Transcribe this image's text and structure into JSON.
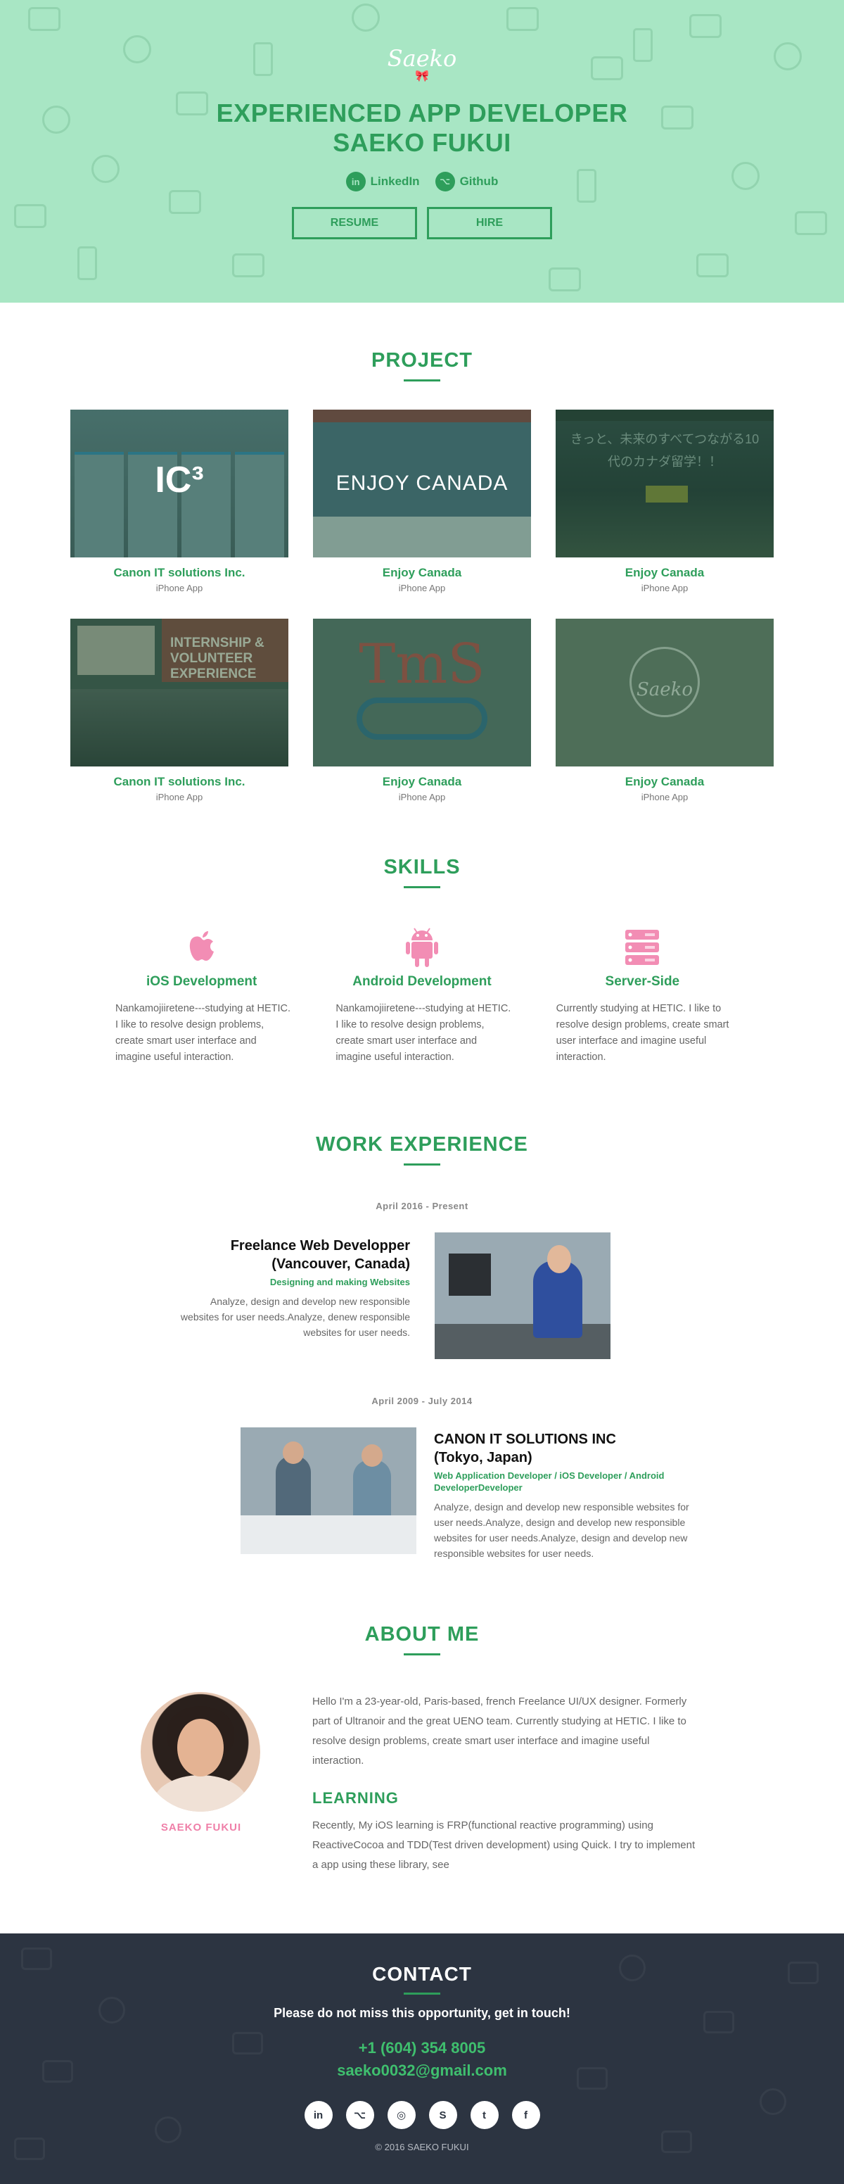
{
  "hero": {
    "logo": "Saeko",
    "logo_bow": "🎀",
    "title_line1": "EXPERIENCED APP DEVELOPER",
    "title_line2": "SAEKO FUKUI",
    "links": [
      {
        "icon": "linkedin-icon",
        "glyph": "in",
        "label": "LinkedIn"
      },
      {
        "icon": "github-icon",
        "glyph": "⌥",
        "label": "Github"
      }
    ],
    "buttons": [
      "RESUME",
      "HIRE"
    ],
    "bg_color": "#a8e6c4",
    "accent": "#2e9e5b"
  },
  "projects": {
    "title": "PROJECT",
    "thumb_texts": {
      "ic3": "IC³",
      "enjoy": "ENJOY CANADA",
      "jp_line1": "きっと、未来のすべてつながる10",
      "jp_line2": "代のカナダ留学！！",
      "internship": "INTERNSHIP & VOLUNTEER EXPERIENCE",
      "tms": "TmS",
      "saeko": "Saeko"
    },
    "items": [
      {
        "name": "Canon IT solutions Inc.",
        "sub": "iPhone App"
      },
      {
        "name": "Enjoy Canada",
        "sub": "iPhone App"
      },
      {
        "name": "Enjoy Canada",
        "sub": "iPhone App"
      },
      {
        "name": "Canon IT solutions Inc.",
        "sub": "iPhone App"
      },
      {
        "name": "Enjoy Canada",
        "sub": "iPhone App"
      },
      {
        "name": "Enjoy Canada",
        "sub": "iPhone App"
      }
    ]
  },
  "skills": {
    "title": "SKILLS",
    "items": [
      {
        "icon": "apple-icon",
        "name": "iOS Development",
        "desc": "Nankamojiiretene---studying at HETIC. I like to resolve design problems, create smart user interface and imagine useful interaction."
      },
      {
        "icon": "android-icon",
        "name": "Android Development",
        "desc": "Nankamojiiretene---studying at HETIC. I like to resolve design problems, create smart user interface and imagine useful interaction."
      },
      {
        "icon": "server-icon",
        "name": "Server-Side",
        "desc": "Currently studying at HETIC. I like to resolve design problems, create smart user interface and imagine useful interaction."
      }
    ]
  },
  "work": {
    "title": "WORK EXPERIENCE",
    "jobs": [
      {
        "period": "April 2016 - Present",
        "title_line1": "Freelance Web Developper",
        "title_line2": "(Vancouver, Canada)",
        "role": "Designing and making Websites",
        "desc": "Analyze, design and develop new responsible websites for user needs.Analyze, denew responsible websites for user needs."
      },
      {
        "period": "April 2009 - July 2014",
        "title_line1": "CANON IT SOLUTIONS INC",
        "title_line2": "(Tokyo, Japan)",
        "role": "Web Application Developer / iOS Developer / Android DeveloperDeveloper",
        "desc": "Analyze, design and develop new responsible websites for user needs.Analyze, design and develop new responsible websites for user needs.Analyze, design and develop new responsible websites for user needs."
      }
    ]
  },
  "about": {
    "title": "ABOUT ME",
    "name": "SAEKO FUKUI",
    "bio": "Hello I'm a 23-year-old, Paris-based, french Freelance UI/UX designer. Formerly part of Ultranoir and the great UENO team. Currently studying at HETIC. I like to resolve design problems, create smart user interface and imagine useful interaction.",
    "learning_title": "LEARNING",
    "learning": "Recently, My iOS learning is FRP(functional reactive programming) using ReactiveCocoa and TDD(Test driven development) using Quick. I try to implement a app using these library, see"
  },
  "contact": {
    "title": "CONTACT",
    "tagline": "Please do not miss this opportunity, get in touch!",
    "phone": "+1 (604) 354 8005",
    "email": "saeko0032@gmail.com",
    "social": [
      {
        "icon": "linkedin-icon",
        "glyph": "in"
      },
      {
        "icon": "github-icon",
        "glyph": "⌥"
      },
      {
        "icon": "instagram-icon",
        "glyph": "◎"
      },
      {
        "icon": "skype-icon",
        "glyph": "S"
      },
      {
        "icon": "tumblr-icon",
        "glyph": "t"
      },
      {
        "icon": "facebook-icon",
        "glyph": "f"
      }
    ],
    "copyright": "© 2016 SAEKO FUKUI",
    "bg_color": "#2c3441"
  }
}
